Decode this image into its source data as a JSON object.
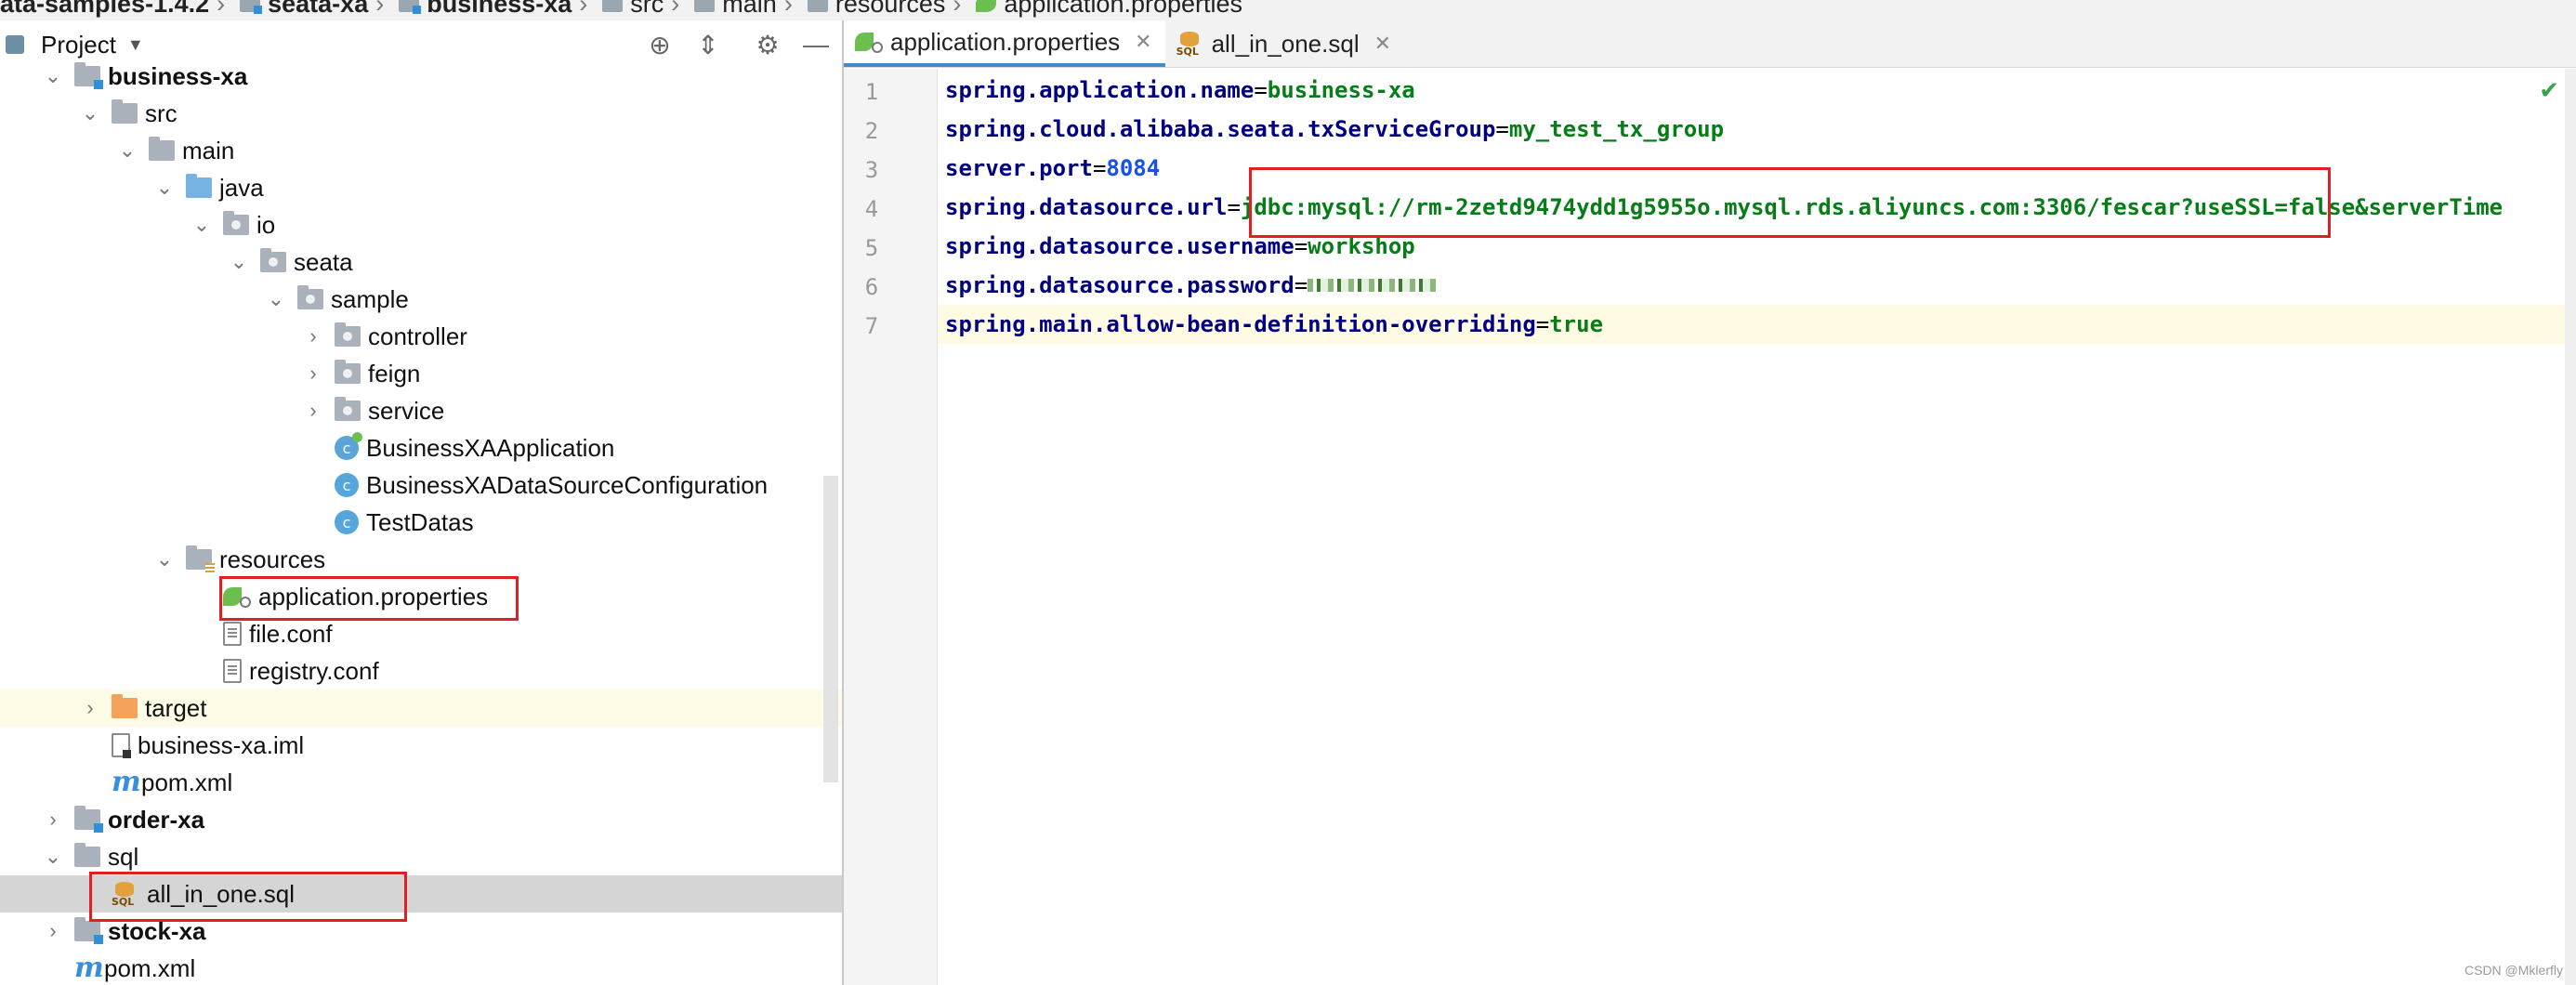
{
  "breadcrumb": [
    "ata-samples-1.4.2",
    "seata-xa",
    "business-xa",
    "src",
    "main",
    "resources",
    "application.properties"
  ],
  "project_panel": {
    "title": "Project",
    "tree": [
      {
        "label": "business-xa",
        "bold": true,
        "icon": "module-folder-icon"
      },
      {
        "label": "src",
        "icon": "folder-icon"
      },
      {
        "label": "main",
        "icon": "folder-icon"
      },
      {
        "label": "java",
        "icon": "source-folder-icon"
      },
      {
        "label": "io",
        "icon": "package-icon"
      },
      {
        "label": "seata",
        "icon": "package-icon"
      },
      {
        "label": "sample",
        "icon": "package-icon"
      },
      {
        "label": "controller",
        "icon": "package-icon"
      },
      {
        "label": "feign",
        "icon": "package-icon"
      },
      {
        "label": "service",
        "icon": "package-icon"
      },
      {
        "label": "BusinessXAApplication",
        "icon": "spring-class-icon"
      },
      {
        "label": "BusinessXADataSourceConfiguration",
        "icon": "class-icon"
      },
      {
        "label": "TestDatas",
        "icon": "class-icon"
      },
      {
        "label": "resources",
        "icon": "resources-folder-icon"
      },
      {
        "label": "application.properties",
        "icon": "properties-file-icon"
      },
      {
        "label": "file.conf",
        "icon": "text-file-icon"
      },
      {
        "label": "registry.conf",
        "icon": "text-file-icon"
      },
      {
        "label": "target",
        "icon": "excluded-folder-icon"
      },
      {
        "label": "business-xa.iml",
        "icon": "iml-file-icon"
      },
      {
        "label": "pom.xml",
        "icon": "maven-icon"
      },
      {
        "label": "order-xa",
        "bold": true,
        "icon": "module-folder-icon"
      },
      {
        "label": "sql",
        "icon": "folder-icon"
      },
      {
        "label": "all_in_one.sql",
        "icon": "sql-file-icon"
      },
      {
        "label": "stock-xa",
        "bold": true,
        "icon": "module-folder-icon"
      },
      {
        "label": "pom.xml",
        "icon": "maven-icon"
      }
    ]
  },
  "editor": {
    "tabs": [
      {
        "label": "application.properties",
        "active": true
      },
      {
        "label": "all_in_one.sql",
        "active": false
      }
    ],
    "lines": [
      {
        "no": "1",
        "key": "spring.application.name",
        "value": "business-xa"
      },
      {
        "no": "2",
        "key": "spring.cloud.alibaba.seata.txServiceGroup",
        "value": "my_test_tx_group"
      },
      {
        "no": "3",
        "key": "server.port",
        "value": "8084"
      },
      {
        "no": "4",
        "key": "spring.datasource.url",
        "value": "jdbc:mysql://rm-2zetd9474ydd1g5955o.mysql.rds.aliyuncs.com:3306/fescar?useSSL=false&serverTime"
      },
      {
        "no": "5",
        "key": "spring.datasource.username",
        "value": "workshop"
      },
      {
        "no": "6",
        "key": "spring.datasource.password",
        "value": ""
      },
      {
        "no": "7",
        "key": "spring.main.allow-bean-definition-overriding",
        "value": "true"
      }
    ]
  },
  "watermark": "CSDN @Mklerfly",
  "colors": {
    "key": "#000080",
    "value": "#067d17",
    "number": "#1750eb",
    "highlight_box": "#e02020",
    "current_line": "#fffae3"
  }
}
